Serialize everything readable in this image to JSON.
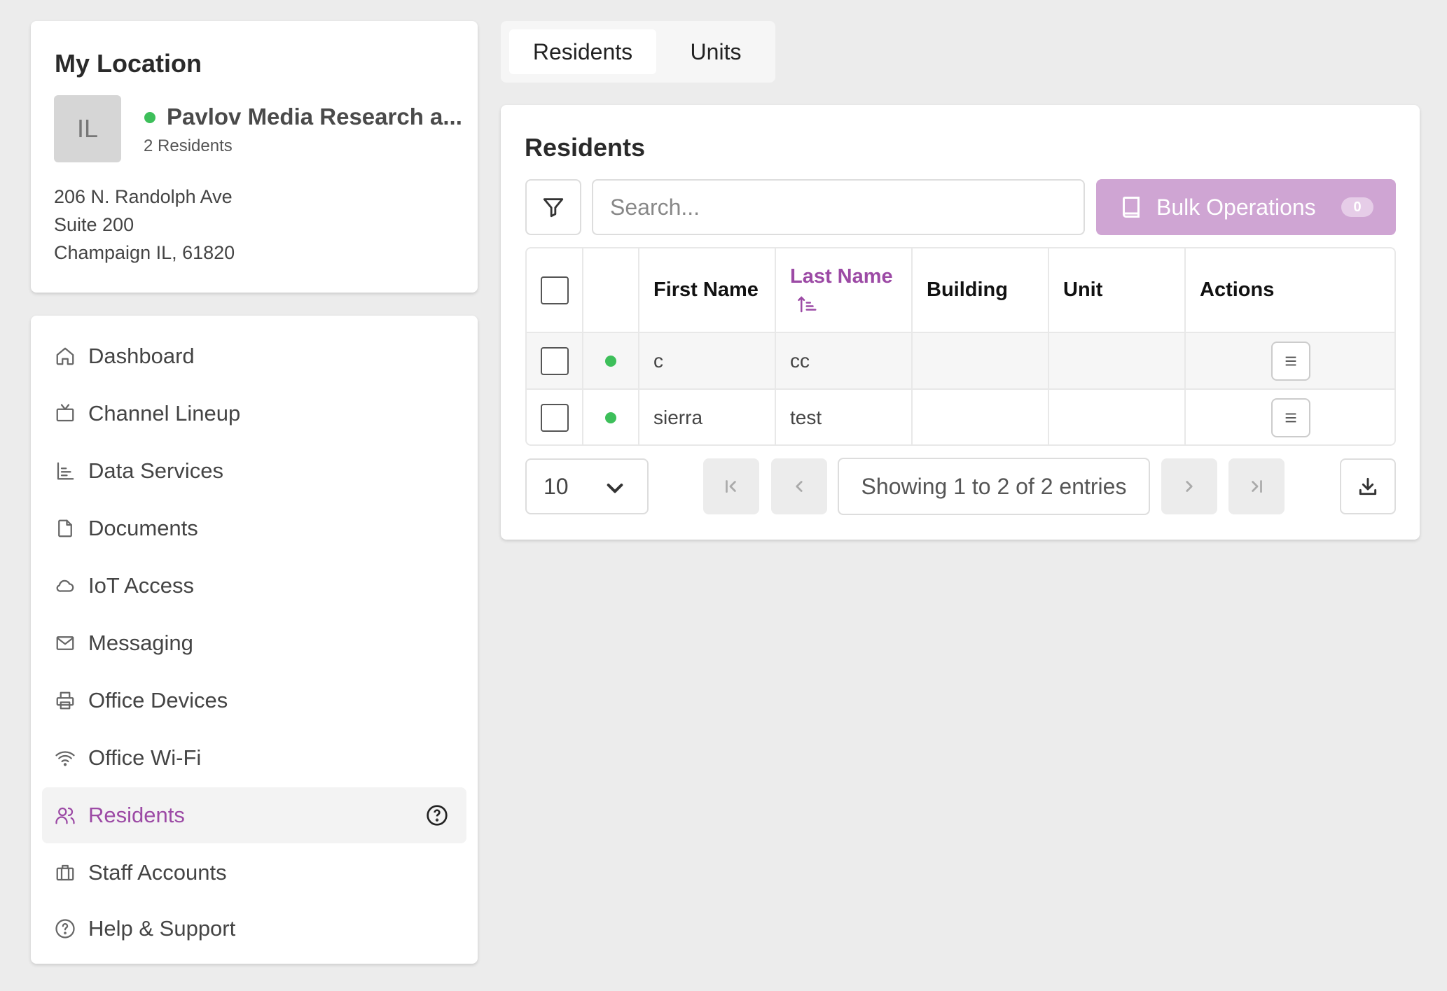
{
  "location": {
    "title": "My Location",
    "avatar_initials": "IL",
    "name": "Pavlov Media Research a...",
    "status_color": "#3dbf5a",
    "resident_count": "2 Residents",
    "address_line1": "206 N. Randolph Ave",
    "address_line2": "Suite 200",
    "address_line3": "Champaign IL, 61820"
  },
  "nav": {
    "accent_color": "#9c4aa5",
    "items": [
      {
        "label": "Dashboard",
        "icon": "home-icon"
      },
      {
        "label": "Channel Lineup",
        "icon": "tv-icon"
      },
      {
        "label": "Data Services",
        "icon": "bar-chart-icon"
      },
      {
        "label": "Documents",
        "icon": "file-icon"
      },
      {
        "label": "IoT Access",
        "icon": "cloud-icon"
      },
      {
        "label": "Messaging",
        "icon": "mail-icon"
      },
      {
        "label": "Office Devices",
        "icon": "printer-icon"
      },
      {
        "label": "Office Wi-Fi",
        "icon": "wifi-icon"
      },
      {
        "label": "Residents",
        "icon": "users-icon",
        "active": true
      },
      {
        "label": "Staff Accounts",
        "icon": "briefcase-icon"
      },
      {
        "label": "Help & Support",
        "icon": "help-circle-icon"
      }
    ]
  },
  "tabs": [
    {
      "label": "Residents",
      "active": true
    },
    {
      "label": "Units",
      "active": false
    }
  ],
  "residents": {
    "title": "Residents",
    "search_placeholder": "Search...",
    "bulk_label": "Bulk Operations",
    "bulk_count": "0",
    "bulk_color": "#cfa5d3",
    "columns": [
      "First Name",
      "Last Name",
      "Building",
      "Unit",
      "Actions"
    ],
    "sorted_column": "Last Name",
    "sort_direction": "ascending",
    "rows": [
      {
        "first_name": "c",
        "last_name": "cc",
        "building": "",
        "unit": "",
        "status_color": "#3dbf5a"
      },
      {
        "first_name": "sierra",
        "last_name": "test",
        "building": "",
        "unit": "",
        "status_color": "#3dbf5a"
      }
    ],
    "page_size": "10",
    "showing": "Showing 1 to 2 of 2 entries"
  }
}
